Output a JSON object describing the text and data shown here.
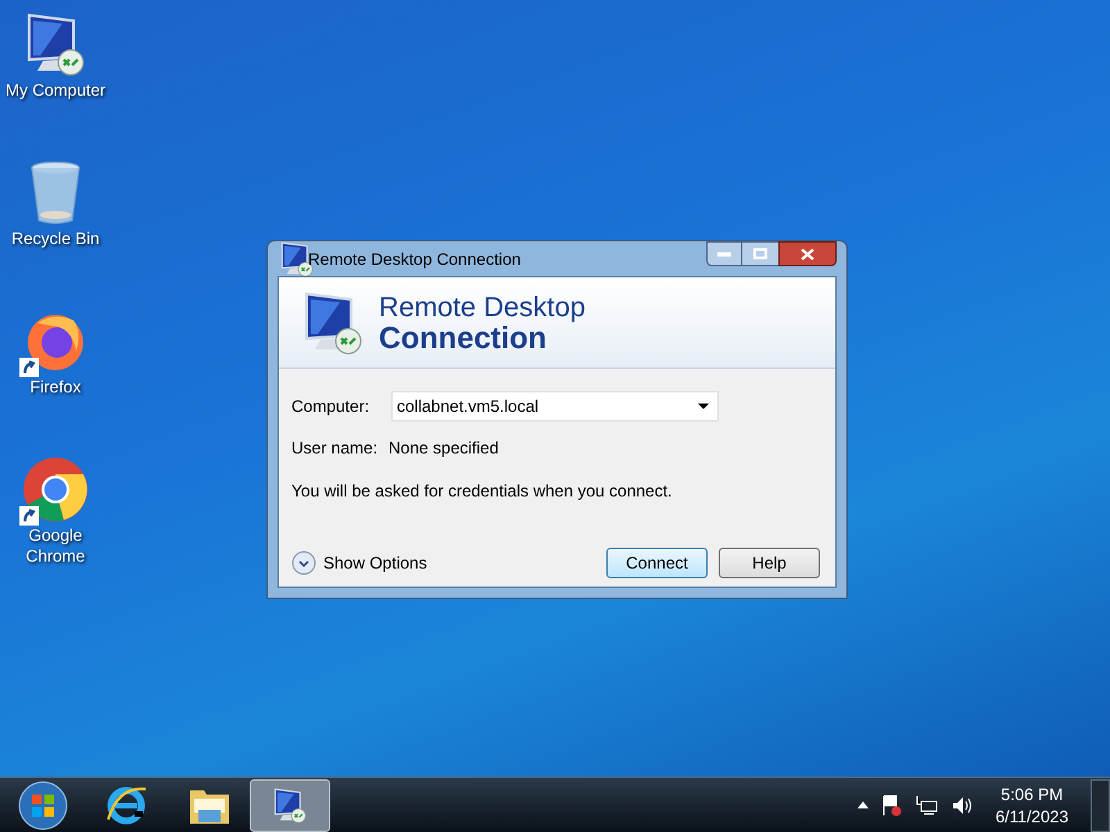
{
  "desktop_icons": [
    {
      "label": "My Computer",
      "kind": "computer",
      "shortcut": false
    },
    {
      "label": "Recycle Bin",
      "kind": "bin",
      "shortcut": false
    },
    {
      "label": "Firefox",
      "kind": "firefox",
      "shortcut": true
    },
    {
      "label": "Google Chrome",
      "kind": "chrome",
      "shortcut": true
    }
  ],
  "window": {
    "title": "Remote Desktop Connection",
    "header_line1": "Remote Desktop",
    "header_line2": "Connection",
    "computer_label": "Computer:",
    "computer_value": "collabnet.vm5.local",
    "username_label": "User name:",
    "username_value": "None specified",
    "info": "You will be asked for credentials when you connect.",
    "show_options": "Show Options",
    "buttons": [
      {
        "label": "Connect",
        "default": true
      },
      {
        "label": "Help",
        "default": false
      }
    ]
  },
  "taskbar": {
    "items": [
      {
        "kind": "start",
        "selected": false
      },
      {
        "kind": "browser",
        "selected": false
      },
      {
        "kind": "folder",
        "selected": false
      },
      {
        "kind": "remote",
        "selected": true
      }
    ],
    "time": "5:06 PM",
    "date": "6/11/2023"
  }
}
